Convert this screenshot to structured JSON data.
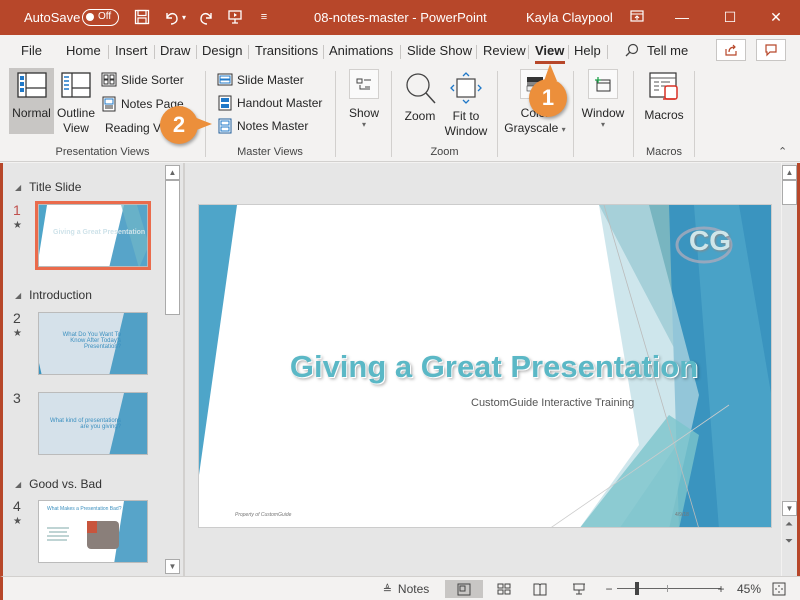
{
  "titlebar": {
    "autosave_label": "AutoSave",
    "autosave_state": "Off",
    "document_title": "08-notes-master",
    "app_separator": "-",
    "app_name": "PowerPoint",
    "user_name": "Kayla Claypool"
  },
  "tabs": [
    {
      "label": "File"
    },
    {
      "label": "Home"
    },
    {
      "label": "Insert"
    },
    {
      "label": "Draw"
    },
    {
      "label": "Design"
    },
    {
      "label": "Transitions"
    },
    {
      "label": "Animations"
    },
    {
      "label": "Slide Show"
    },
    {
      "label": "Review"
    },
    {
      "label": "View",
      "active": true
    },
    {
      "label": "Help"
    }
  ],
  "tell_me": "Tell me",
  "ribbon": {
    "presentation_views": {
      "label": "Presentation Views",
      "normal": "Normal",
      "outline_line1": "Outline",
      "outline_line2": "View",
      "slide_sorter": "Slide Sorter",
      "notes_page": "Notes Page",
      "reading_view": "Reading View"
    },
    "master_views": {
      "label": "Master Views",
      "slide_master": "Slide Master",
      "handout_master": "Handout Master",
      "notes_master": "Notes Master"
    },
    "show": {
      "label": "Show"
    },
    "zoom_group": {
      "label": "Zoom",
      "zoom": "Zoom",
      "fit_line1": "Fit to",
      "fit_line2": "Window"
    },
    "color": {
      "line1": "Color",
      "line2": "Grayscale"
    },
    "window": {
      "label": "Window"
    },
    "macros": {
      "label": "Macros",
      "button": "Macros"
    }
  },
  "callouts": {
    "one": "1",
    "two": "2"
  },
  "slides_pane": {
    "sections": [
      {
        "name": "Title Slide"
      },
      {
        "name": "Introduction"
      },
      {
        "name": "Good vs. Bad"
      }
    ],
    "slides": [
      {
        "number": "1",
        "title": "Giving a Great Presentation",
        "animated": true,
        "selected": true
      },
      {
        "number": "2",
        "title": "What Do You Want To Know After Today's Presentation?",
        "animated": true
      },
      {
        "number": "3",
        "title": "What kind of presentations are you giving?",
        "animated": false
      },
      {
        "number": "4",
        "title": "What Makes a Presentation Bad?",
        "animated": true
      }
    ]
  },
  "current_slide": {
    "title": "Giving a Great Presentation",
    "subtitle": "CustomGuide Interactive Training",
    "footer": "Property of CustomGuide",
    "date": "4/9/18",
    "logo": "CG"
  },
  "statusbar": {
    "notes_label": "Notes",
    "zoom_percent": "45%",
    "zoom_value": 45
  },
  "colors": {
    "accent": "#b7472a",
    "callout": "#ec8f3b",
    "title_teal": "#5bb8c6",
    "slide_blue": "#3a94bf"
  }
}
